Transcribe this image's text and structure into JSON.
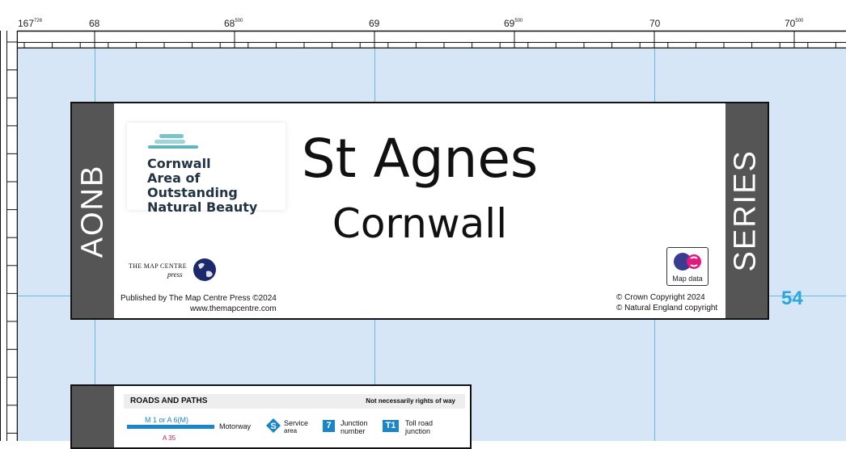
{
  "ruler": {
    "ticks": [
      {
        "main": "167",
        "sup": "726",
        "prefix": "┌"
      },
      {
        "main": "68",
        "sup": ""
      },
      {
        "main": "68",
        "sup": "500"
      },
      {
        "main": "69",
        "sup": ""
      },
      {
        "main": "69",
        "sup": "500"
      },
      {
        "main": "70",
        "sup": ""
      },
      {
        "main": "70",
        "sup": "500"
      }
    ]
  },
  "title_panel": {
    "left_band": "AONB",
    "right_band": "SERIES",
    "title": "St Agnes",
    "subtitle": "Cornwall",
    "aonb_logo": {
      "line1": "Cornwall",
      "line2": "Area of Outstanding",
      "line3": "Natural Beauty"
    },
    "publisher_logo": {
      "line1": "The Map Centre",
      "line2": "press"
    },
    "published_by": "Published by The Map Centre Press ©2024",
    "website": "www.themapcentre.com",
    "os_label": "Map data",
    "copyright1": "© Crown Copyright 2024",
    "copyright2": "© Natural England copyright"
  },
  "map_number": "54",
  "legend": {
    "title": "ROADS AND PATHS",
    "note": "Not necessarily rights of way",
    "motorway_route": "M 1 or A 6(M)",
    "motorway": "Motorway",
    "a_road": "A 35",
    "service": "Service",
    "service2": "area",
    "junction_num": "7",
    "junction": "Junction",
    "junction2": "number",
    "toll_num": "T1",
    "toll": "Toll road",
    "toll2": "junction"
  },
  "colors": {
    "map_bg": "#d6e6f6",
    "grid": "#68b9dc",
    "band": "#555555",
    "accent": "#29a8df"
  }
}
